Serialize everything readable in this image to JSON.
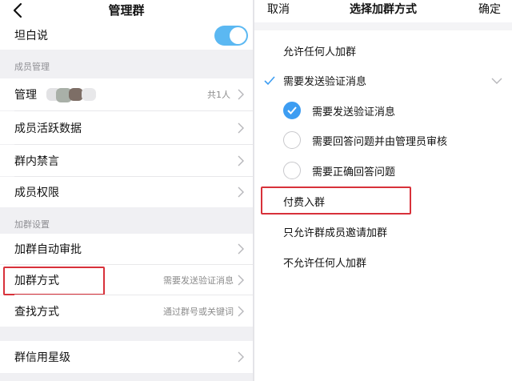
{
  "left_panel": {
    "title": "管理群",
    "toggle_row": {
      "label": "坦白说",
      "on": true
    },
    "section_member": "成员管理",
    "member_admin": {
      "label": "管理",
      "value": "共1人"
    },
    "member_activity": {
      "label": "成员活跃数据"
    },
    "group_mute": {
      "label": "群内禁言"
    },
    "member_permission": {
      "label": "成员权限"
    },
    "section_join": "加群设置",
    "auto_approve": {
      "label": "加群自动审批"
    },
    "join_method": {
      "label": "加群方式",
      "value": "需要发送验证消息"
    },
    "find_method": {
      "label": "查找方式",
      "value": "通过群号或关键词"
    },
    "credit_rating": {
      "label": "群信用星级"
    }
  },
  "right_panel": {
    "cancel": "取消",
    "title": "选择加群方式",
    "confirm": "确定",
    "options": [
      {
        "label": "允许任何人加群"
      },
      {
        "label": "需要发送验证消息",
        "selected": true
      },
      {
        "label": "付费入群"
      },
      {
        "label": "只允许群成员邀请加群"
      },
      {
        "label": "不允许任何人加群"
      }
    ],
    "sub_options": [
      {
        "label": "需要发送验证消息",
        "checked": true
      },
      {
        "label": "需要回答问题并由管理员审核",
        "checked": false
      },
      {
        "label": "需要正确回答问题",
        "checked": false
      }
    ]
  },
  "colors": {
    "accent": "#3d9df2",
    "toggle": "#5bb8f2",
    "highlight_box": "#d8313a",
    "background": "#f0f0f3"
  },
  "icons": [
    "chevron-left-icon",
    "chevron-right-icon",
    "checkmark-icon",
    "chevron-down-icon"
  ]
}
